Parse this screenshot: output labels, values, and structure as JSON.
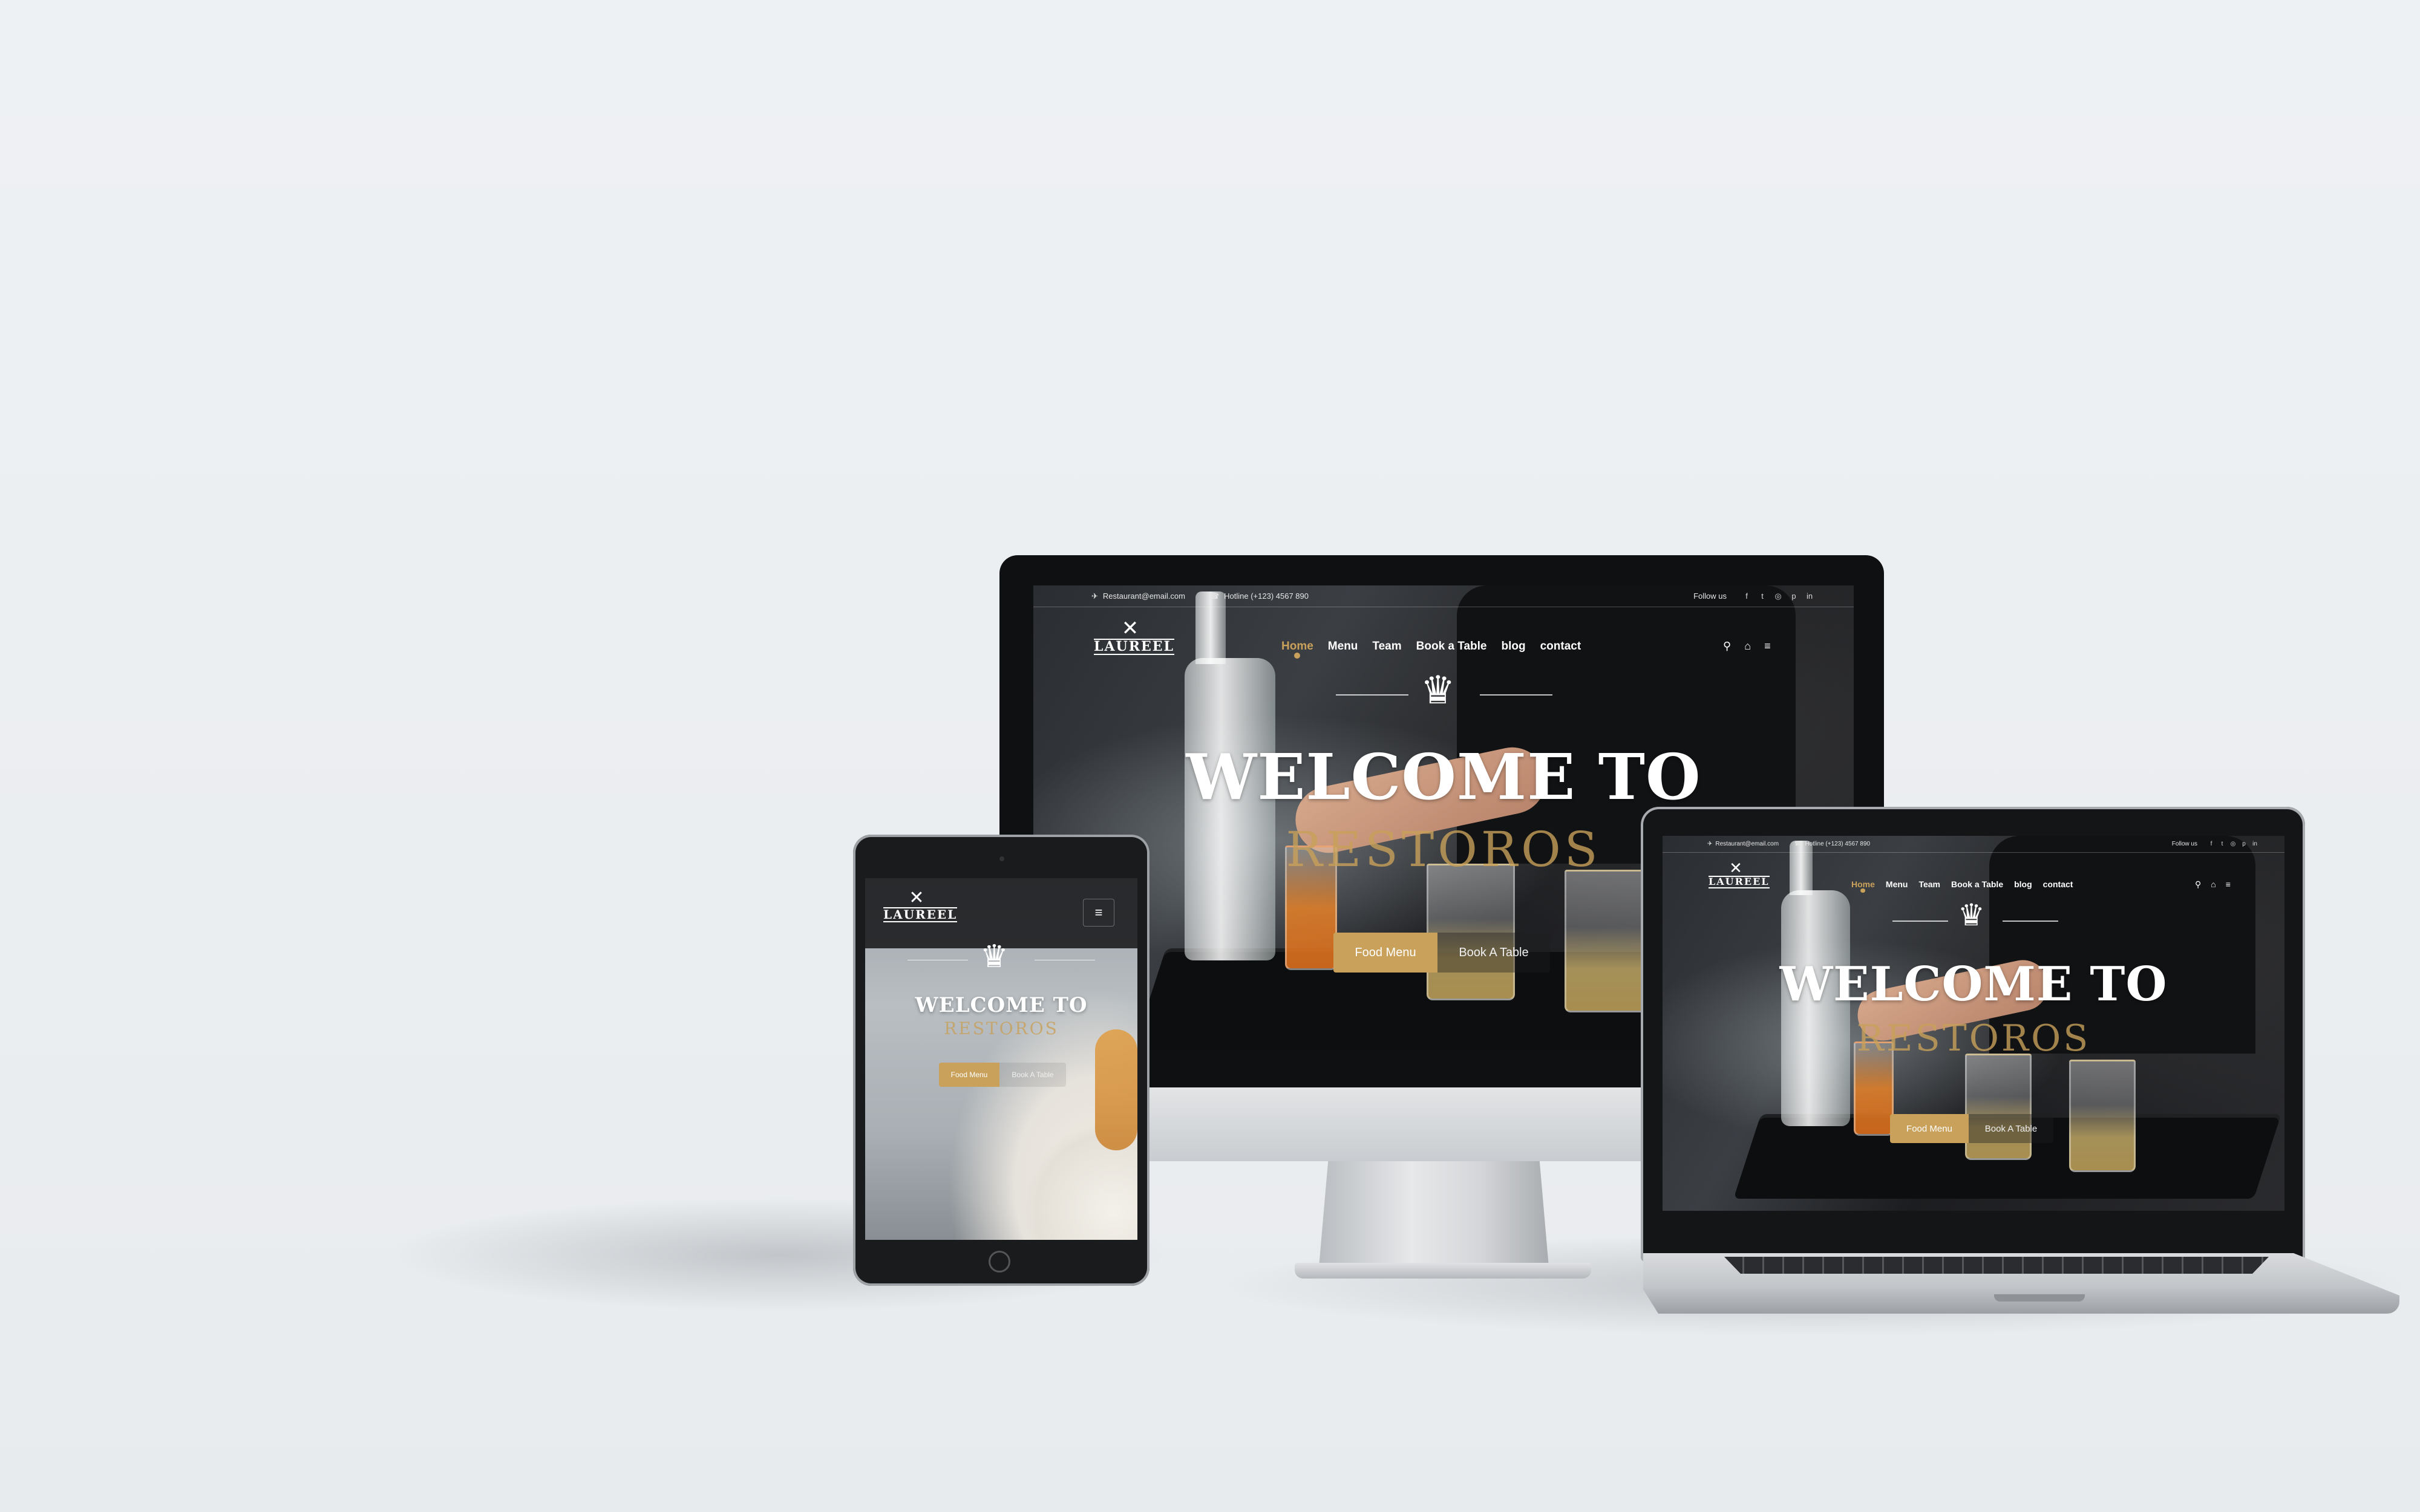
{
  "site": {
    "email": "Restaurant@email.com",
    "hotline": "Hotline (+123) 4567 890",
    "follow_label": "Follow us",
    "social": [
      {
        "icon": "facebook-icon",
        "glyph": "f"
      },
      {
        "icon": "twitter-icon",
        "glyph": "t"
      },
      {
        "icon": "instagram-icon",
        "glyph": "◎"
      },
      {
        "icon": "pinterest-icon",
        "glyph": "p"
      },
      {
        "icon": "linkedin-icon",
        "glyph": "in"
      }
    ],
    "logo_text": "LAUREEL",
    "nav": [
      "Home",
      "Menu",
      "Team",
      "Book a Table",
      "blog",
      "contact"
    ],
    "active_nav": "Home",
    "hero_title": "WELCOME TO",
    "hero_subtitle": "RESTOROS",
    "btn_primary": "Food Menu",
    "btn_secondary": "Book A Table",
    "icons": [
      "search-icon",
      "cart-icon",
      "menu-icon"
    ],
    "colors": {
      "accent": "#c9a15a",
      "text_light": "#ffffff"
    }
  }
}
